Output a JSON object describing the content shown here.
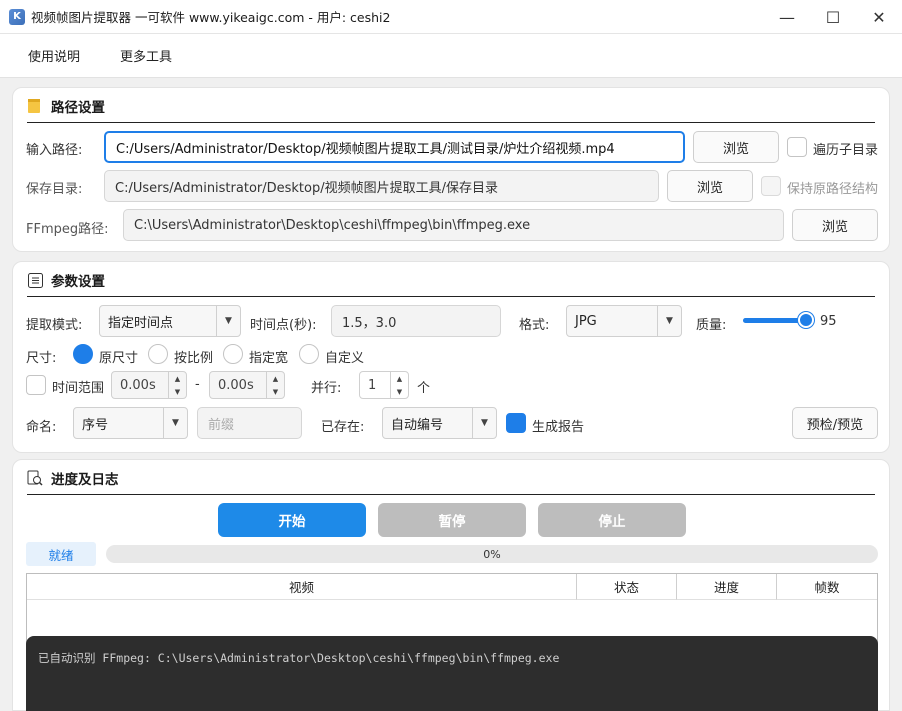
{
  "window": {
    "title": "视频帧图片提取器 一可软件 www.yikeaigc.com - 用户: ceshi2",
    "minimize": "—",
    "maximize": "☐",
    "close": "✕"
  },
  "menu": [
    "使用说明",
    "更多工具"
  ],
  "path_section": {
    "title": "路径设置",
    "input_label": "输入路径:",
    "input_value": "C:/Users/Administrator/Desktop/视频帧图片提取工具/测试目录/炉灶介绍视频.mp4",
    "browse1": "浏览",
    "traverse_label": "遍历子目录",
    "save_label": "保存目录:",
    "save_value": "C:/Users/Administrator/Desktop/视频帧图片提取工具/保存目录",
    "browse2": "浏览",
    "keep_structure_label": "保持原路径结构",
    "ffmpeg_label": "FFmpeg路径:",
    "ffmpeg_value": "C:\\Users\\Administrator\\Desktop\\ceshi\\ffmpeg\\bin\\ffmpeg.exe",
    "browse3": "浏览"
  },
  "param_section": {
    "title": "参数设置",
    "mode_label": "提取模式:",
    "mode_value": "指定时间点",
    "time_label": "时间点(秒):",
    "time_value": "1.5，3.0",
    "format_label": "格式:",
    "format_value": "JPG",
    "quality_label": "质量:",
    "quality_value": "95",
    "quality_fraction": 0.95,
    "size_label": "尺寸:",
    "size_options": [
      "原尺寸",
      "按比例",
      "指定宽",
      "自定义"
    ],
    "size_selected": 0,
    "time_range_label": "时间范围",
    "range_start": "0.00s",
    "range_sep": "-",
    "range_end": "0.00s",
    "parallel_label": "并行:",
    "parallel_value": "1",
    "parallel_unit": "个",
    "naming_label": "命名:",
    "naming_value": "序号",
    "prefix_placeholder": "前缀",
    "exists_label": "已存在:",
    "exists_value": "自动编号",
    "report_label": "生成报告",
    "preview_button": "预检/预览"
  },
  "progress_section": {
    "title": "进度及日志",
    "start": "开始",
    "pause": "暂停",
    "stop": "停止",
    "status": "就绪",
    "progress_text": "0%",
    "columns": [
      "视频",
      "状态",
      "进度",
      "帧数"
    ],
    "log_line": "已自动识别 FFmpeg: C:\\Users\\Administrator\\Desktop\\ceshi\\ffmpeg\\bin\\ffmpeg.exe"
  },
  "colors": {
    "accent": "#1e7ee8",
    "disabled_button": "#bdbdbd",
    "log_background": "#2d2d2d"
  }
}
